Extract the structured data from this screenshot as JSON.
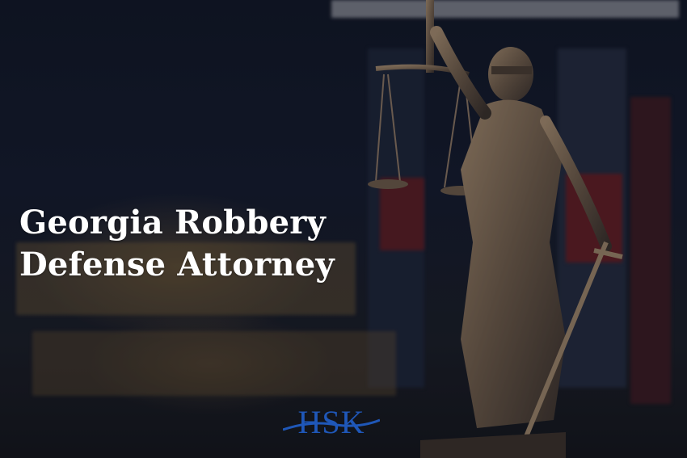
{
  "hero": {
    "headline_line1": "Georgia Robbery",
    "headline_line2": "Defense Attorney"
  },
  "logo": {
    "text": "HSK",
    "color": "#1f57b8"
  },
  "scene": {
    "subject": "statue-of-lady-justice",
    "background": "blurred-law-books"
  }
}
